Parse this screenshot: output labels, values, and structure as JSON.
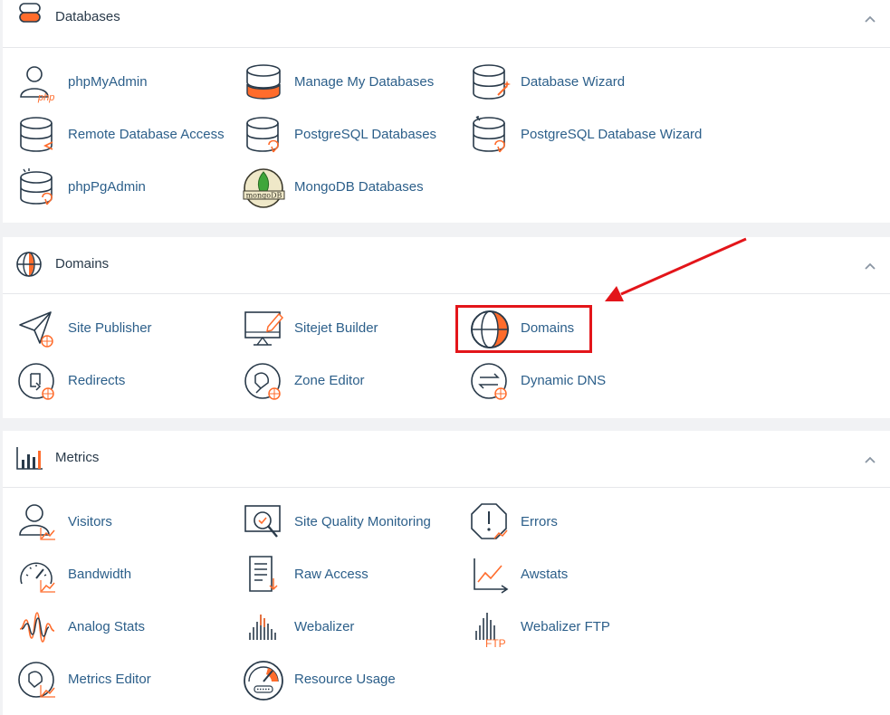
{
  "sections": [
    {
      "title": "Databases",
      "items": [
        {
          "label": "phpMyAdmin",
          "icon": "phpmyadmin-icon"
        },
        {
          "label": "Manage My Databases",
          "icon": "manage-databases-icon"
        },
        {
          "label": "Database Wizard",
          "icon": "database-wizard-icon"
        },
        {
          "label": "Remote Database Access",
          "icon": "remote-database-icon"
        },
        {
          "label": "PostgreSQL Databases",
          "icon": "postgresql-databases-icon"
        },
        {
          "label": "PostgreSQL Database Wizard",
          "icon": "postgresql-wizard-icon"
        },
        {
          "label": "phpPgAdmin",
          "icon": "phppgadmin-icon"
        },
        {
          "label": "MongoDB Databases",
          "icon": "mongodb-icon",
          "icon_text": "mongoDB"
        }
      ]
    },
    {
      "title": "Domains",
      "items": [
        {
          "label": "Site Publisher",
          "icon": "site-publisher-icon"
        },
        {
          "label": "Sitejet Builder",
          "icon": "sitejet-builder-icon"
        },
        {
          "label": "Domains",
          "icon": "domains-globe-icon"
        },
        {
          "label": "Redirects",
          "icon": "redirects-icon"
        },
        {
          "label": "Zone Editor",
          "icon": "zone-editor-icon"
        },
        {
          "label": "Dynamic DNS",
          "icon": "dynamic-dns-icon"
        }
      ]
    },
    {
      "title": "Metrics",
      "items": [
        {
          "label": "Visitors",
          "icon": "visitors-icon"
        },
        {
          "label": "Site Quality Monitoring",
          "icon": "site-quality-icon"
        },
        {
          "label": "Errors",
          "icon": "errors-icon"
        },
        {
          "label": "Bandwidth",
          "icon": "bandwidth-icon"
        },
        {
          "label": "Raw Access",
          "icon": "raw-access-icon"
        },
        {
          "label": "Awstats",
          "icon": "awstats-icon"
        },
        {
          "label": "Analog Stats",
          "icon": "analog-stats-icon"
        },
        {
          "label": "Webalizer",
          "icon": "webalizer-icon"
        },
        {
          "label": "Webalizer FTP",
          "icon": "webalizer-ftp-icon",
          "icon_text": "FTP"
        },
        {
          "label": "Metrics Editor",
          "icon": "metrics-editor-icon"
        },
        {
          "label": "Resource Usage",
          "icon": "resource-usage-icon"
        }
      ]
    }
  ],
  "colors": {
    "accent": "#ff6c2c",
    "link": "#2c5f8a",
    "highlight": "#e3151a",
    "icon_stroke": "#293a4a"
  }
}
